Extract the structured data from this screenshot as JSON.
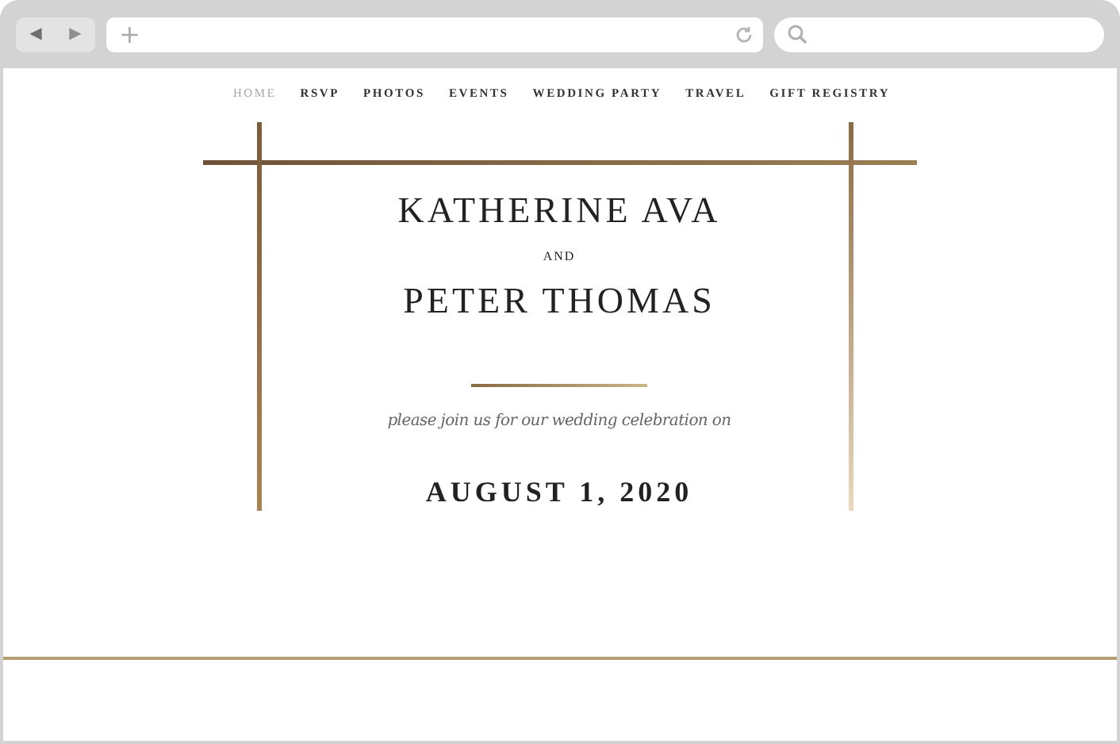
{
  "browser": {
    "back": "◀",
    "forward": "▶",
    "new_tab": "+"
  },
  "nav": [
    {
      "label": "HOME",
      "selected": true
    },
    {
      "label": "RSVP",
      "selected": false
    },
    {
      "label": "PHOTOS",
      "selected": false
    },
    {
      "label": "EVENTS",
      "selected": false
    },
    {
      "label": "WEDDING PARTY",
      "selected": false
    },
    {
      "label": "TRAVEL",
      "selected": false
    },
    {
      "label": "GIFT REGISTRY",
      "selected": false
    }
  ],
  "hero": {
    "name_1": "KATHERINE AVA",
    "conjunction": "AND",
    "name_2": "PETER THOMAS",
    "invitation": "please join us for our wedding celebration on",
    "date": "AUGUST 1, 2020"
  }
}
